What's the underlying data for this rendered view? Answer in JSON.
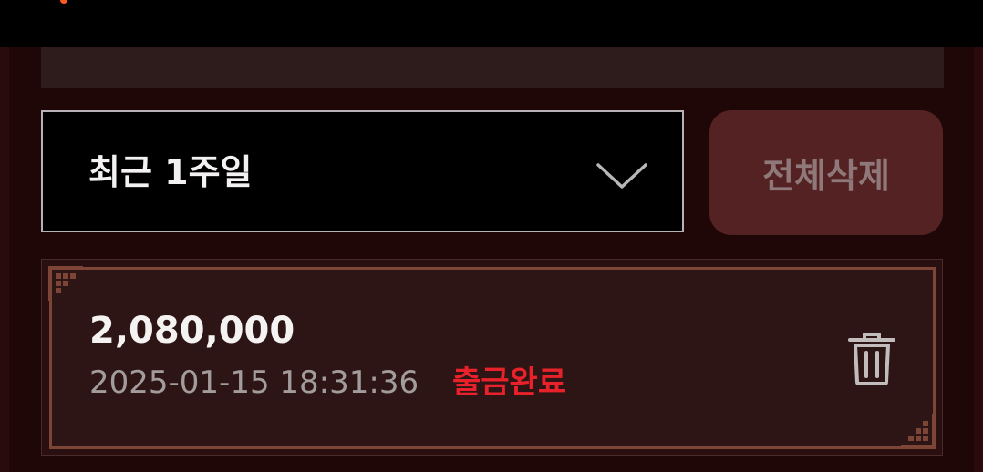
{
  "filter": {
    "period_label": "최근 1주일",
    "delete_all_label": "전체삭제"
  },
  "records": [
    {
      "amount": "2,080,000",
      "datetime": "2025-01-15 18:31:36",
      "status": "출금완료"
    }
  ],
  "colors": {
    "accent_status": "#e8212a",
    "card_border": "#7c4536",
    "delete_button_bg": "#552223",
    "background": "#1f0708"
  },
  "icons": {
    "dropdown": "chevron-down-icon",
    "delete": "trash-icon",
    "card_corner": "ornament-corner-icon"
  }
}
